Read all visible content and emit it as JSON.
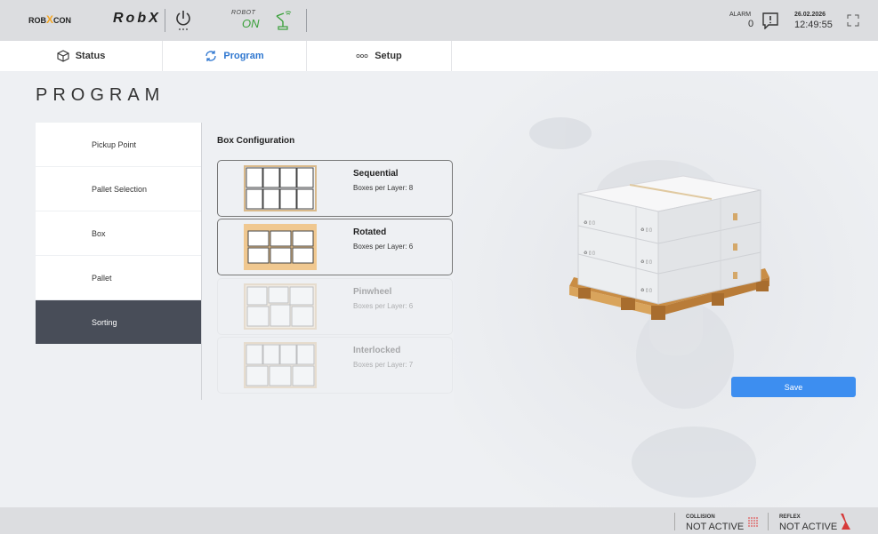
{
  "header": {
    "logo_left": "ROB",
    "logo_x": "X",
    "logo_right": "CON",
    "brand": "RobX",
    "robot_label": "ROBOT",
    "robot_state": "ON",
    "robot_state_color": "#3aa03a",
    "alarm_label": "ALARM",
    "alarm_count": "0",
    "date": "26.02.2026",
    "time": "12:49:55",
    "icons": [
      "power-icon",
      "robot-arm-icon",
      "alarm-icon",
      "expand-icon"
    ]
  },
  "tabs": [
    {
      "label": "Status",
      "icon": "cube-icon",
      "active": false
    },
    {
      "label": "Program",
      "icon": "refresh-icon",
      "active": true
    },
    {
      "label": "Setup",
      "icon": "dots-icon",
      "active": false
    }
  ],
  "page": {
    "title": "PROGRAM"
  },
  "sidebar": {
    "items": [
      {
        "label": "Pickup Point",
        "active": false
      },
      {
        "label": "Pallet Selection",
        "active": false
      },
      {
        "label": "Box",
        "active": false
      },
      {
        "label": "Pallet",
        "active": false
      },
      {
        "label": "Sorting",
        "active": true
      }
    ]
  },
  "config": {
    "title": "Box Configuration",
    "options": [
      {
        "name": "Sequential",
        "sub": "Boxes per Layer: 8",
        "enabled": true
      },
      {
        "name": "Rotated",
        "sub": "Boxes per Layer: 6",
        "enabled": true
      },
      {
        "name": "Pinwheel",
        "sub": "Boxes per Layer: 6",
        "enabled": false
      },
      {
        "name": "Interlocked",
        "sub": "Boxes per Layer: 7",
        "enabled": false
      }
    ]
  },
  "actions": {
    "save_label": "Save"
  },
  "footer": {
    "collision_label": "COLLISION",
    "collision_value": "NOT ACTIVE",
    "reflex_label": "REFLEX",
    "reflex_value": "NOT ACTIVE"
  },
  "colors": {
    "accent": "#2f77d0",
    "save_button": "#3d8ef0",
    "active_sidebar": "#484d58",
    "logo_x": "#f5a623",
    "pallet_wood": "#d9a45c",
    "collision_icon": "#e05050",
    "reflex_icon": "#d63a3a"
  }
}
